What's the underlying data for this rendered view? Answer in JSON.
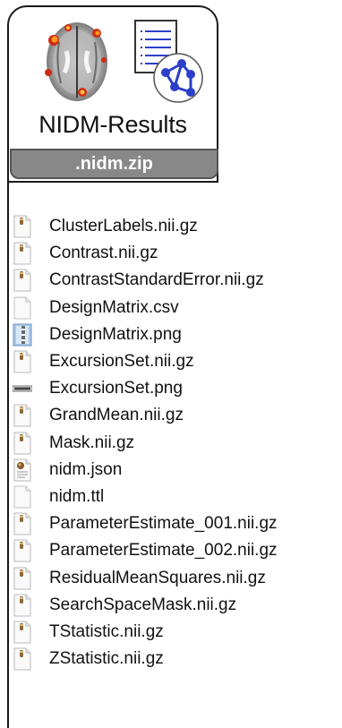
{
  "header": {
    "title": "NIDM-Results",
    "zip_label": ".nidm.zip"
  },
  "icons": {
    "brain": "brain-activation-icon",
    "document": "document-list-icon",
    "graph": "network-graph-icon",
    "accent_blue": "#2b3fc7",
    "activation": "#ff9a1c"
  },
  "files": [
    {
      "name": "ClusterLabels.nii.gz",
      "icon": "nifti"
    },
    {
      "name": "Contrast.nii.gz",
      "icon": "nifti"
    },
    {
      "name": "ContrastStandardError.nii.gz",
      "icon": "nifti"
    },
    {
      "name": "DesignMatrix.csv",
      "icon": "blank"
    },
    {
      "name": "DesignMatrix.png",
      "icon": "image-matrix"
    },
    {
      "name": "ExcursionSet.nii.gz",
      "icon": "nifti"
    },
    {
      "name": "ExcursionSet.png",
      "icon": "image-strip"
    },
    {
      "name": "GrandMean.nii.gz",
      "icon": "nifti"
    },
    {
      "name": "Mask.nii.gz",
      "icon": "nifti"
    },
    {
      "name": "nidm.json",
      "icon": "json"
    },
    {
      "name": "nidm.ttl",
      "icon": "blank"
    },
    {
      "name": "ParameterEstimate_001.nii.gz",
      "icon": "nifti"
    },
    {
      "name": "ParameterEstimate_002.nii.gz",
      "icon": "nifti"
    },
    {
      "name": "ResidualMeanSquares.nii.gz",
      "icon": "nifti"
    },
    {
      "name": "SearchSpaceMask.nii.gz",
      "icon": "nifti"
    },
    {
      "name": "TStatistic.nii.gz",
      "icon": "nifti"
    },
    {
      "name": "ZStatistic.nii.gz",
      "icon": "nifti"
    }
  ]
}
